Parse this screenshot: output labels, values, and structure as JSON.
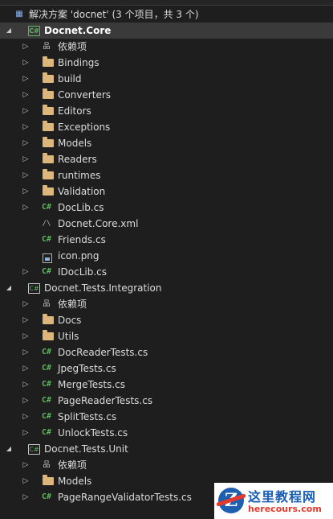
{
  "solution": {
    "label": "解决方案 'docnet' (3 个项目，共 3 个)"
  },
  "projects": [
    {
      "name": "Docnet.Core",
      "items": [
        {
          "label": "依赖项",
          "kind": "dependencies",
          "expandable": true
        },
        {
          "label": "Bindings",
          "kind": "folder",
          "expandable": true
        },
        {
          "label": "build",
          "kind": "folder",
          "expandable": true
        },
        {
          "label": "Converters",
          "kind": "folder",
          "expandable": true
        },
        {
          "label": "Editors",
          "kind": "folder",
          "expandable": true
        },
        {
          "label": "Exceptions",
          "kind": "folder",
          "expandable": true
        },
        {
          "label": "Models",
          "kind": "folder",
          "expandable": true
        },
        {
          "label": "Readers",
          "kind": "folder",
          "expandable": true
        },
        {
          "label": "runtimes",
          "kind": "folder",
          "expandable": true
        },
        {
          "label": "Validation",
          "kind": "folder",
          "expandable": true
        },
        {
          "label": "DocLib.cs",
          "kind": "cs",
          "expandable": true
        },
        {
          "label": "Docnet.Core.xml",
          "kind": "xml",
          "expandable": false
        },
        {
          "label": "Friends.cs",
          "kind": "cs",
          "expandable": false
        },
        {
          "label": "icon.png",
          "kind": "image",
          "expandable": false
        },
        {
          "label": "IDocLib.cs",
          "kind": "cs",
          "expandable": true
        }
      ]
    },
    {
      "name": "Docnet.Tests.Integration",
      "items": [
        {
          "label": "依赖项",
          "kind": "dependencies",
          "expandable": true
        },
        {
          "label": "Docs",
          "kind": "folder",
          "expandable": true
        },
        {
          "label": "Utils",
          "kind": "folder",
          "expandable": true
        },
        {
          "label": "DocReaderTests.cs",
          "kind": "cs",
          "expandable": true
        },
        {
          "label": "JpegTests.cs",
          "kind": "cs",
          "expandable": true
        },
        {
          "label": "MergeTests.cs",
          "kind": "cs",
          "expandable": true
        },
        {
          "label": "PageReaderTests.cs",
          "kind": "cs",
          "expandable": true
        },
        {
          "label": "SplitTests.cs",
          "kind": "cs",
          "expandable": true
        },
        {
          "label": "UnlockTests.cs",
          "kind": "cs",
          "expandable": true
        }
      ]
    },
    {
      "name": "Docnet.Tests.Unit",
      "items": [
        {
          "label": "依赖项",
          "kind": "dependencies",
          "expandable": true
        },
        {
          "label": "Models",
          "kind": "folder",
          "expandable": true
        },
        {
          "label": "PageRangeValidatorTests.cs",
          "kind": "cs",
          "expandable": true
        }
      ]
    }
  ],
  "icons": {
    "csharp": "C#",
    "dependencies": "品",
    "project_cs": "C#",
    "xml": "/\\",
    "solution": "▦"
  },
  "watermark": {
    "logo_letter": "Z",
    "title": "这里教程网",
    "url": "herecours.com"
  },
  "colors": {
    "background": "#1e1e1e",
    "folder": "#dcb67a",
    "csharp": "#5cb85c",
    "selected_row": "#3a3a3a"
  }
}
